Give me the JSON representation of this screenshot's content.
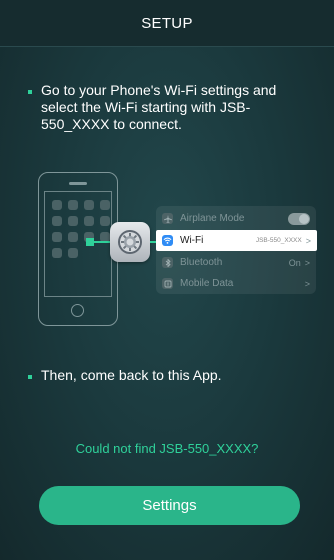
{
  "header": {
    "title": "SETUP"
  },
  "instructions": {
    "step1": "Go to your Phone's Wi-Fi settings and select the Wi-Fi starting with JSB-550_XXXX to connect.",
    "step2": "Then, come back to this App."
  },
  "illustration": {
    "rows": [
      {
        "label": "Airplane Mode",
        "value": "",
        "icon": "airplane-icon"
      },
      {
        "label": "Wi-Fi",
        "value": "JSB-550_XXXX",
        "icon": "wifi-icon"
      },
      {
        "label": "Bluetooth",
        "value": "On",
        "icon": "bluetooth-icon"
      },
      {
        "label": "Mobile Data",
        "value": "",
        "icon": "mobile-data-icon"
      }
    ],
    "chevron": ">"
  },
  "links": {
    "not_found": "Could not find JSB-550_XXXX?"
  },
  "actions": {
    "settings_label": "Settings"
  },
  "colors": {
    "accent": "#2fd19a",
    "button": "#2ab58a",
    "background": "#1b3a3e",
    "wifi_icon": "#2f8cf5"
  }
}
